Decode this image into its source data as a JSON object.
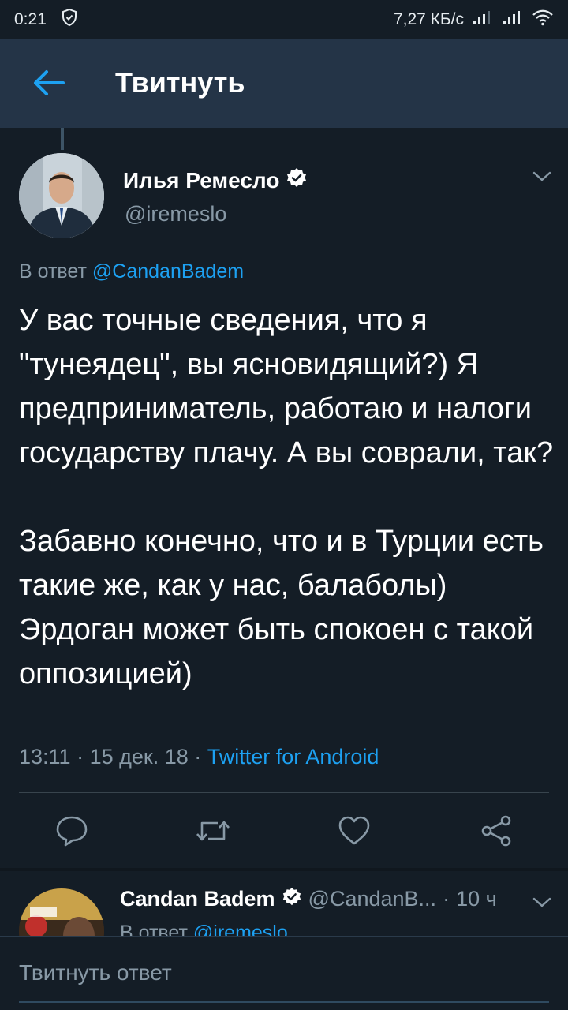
{
  "status_bar": {
    "time": "0:21",
    "network_speed": "7,27 КБ/с",
    "icons": [
      "shield-icon",
      "signal-icon",
      "signal-icon",
      "wifi-icon"
    ]
  },
  "header": {
    "back_icon": "arrow-left-icon",
    "title": "Твитнуть"
  },
  "tweet": {
    "author_name": "Илья Ремесло",
    "verified": true,
    "handle": "@iremeslo",
    "reply_prefix": "В ответ",
    "reply_mention": "@CandanBadem",
    "text": "У вас точные сведения, что я \"тунеядец\", вы ясновидящий?) Я предприниматель, работаю и налоги государству плачу. А вы соврали, так?\n\nЗабавно конечно, что и в Турции есть такие же, как у нас, балаболы) Эрдоган может быть спокоен с такой оппозицией)",
    "time": "13:11",
    "date": "15 дек. 18",
    "source": "Twitter for Android",
    "actions": [
      "reply-icon",
      "retweet-icon",
      "like-icon",
      "share-icon"
    ]
  },
  "reply_tweet": {
    "author_name": "Candan Badem",
    "verified": true,
    "handle": "@CandanB...",
    "time": "10 ч",
    "reply_prefix": "В ответ",
    "reply_mention": "@iremeslo"
  },
  "compose": {
    "placeholder": "Твитнуть ответ"
  },
  "colors": {
    "background": "#141d26",
    "header": "#243447",
    "accent": "#1da1f2",
    "secondary_text": "#8899a6"
  }
}
